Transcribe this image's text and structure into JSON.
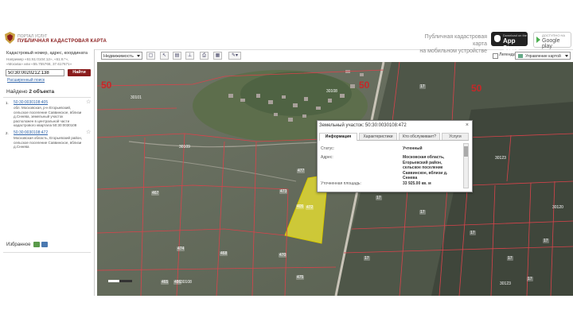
{
  "header": {
    "portal_small": "ПОРТАЛ УСЛУГ",
    "portal_title": "ПУБЛИЧНАЯ КАДАСТРОВАЯ КАРТА",
    "mobile_line1": "Публичная кадастровая карта",
    "mobile_line2": "на мобильном устройстве",
    "appstore_small": "Download on the",
    "appstore_big": "App Store",
    "gplay_small": "ДОСТУПНО НА",
    "gplay_big": "Google play"
  },
  "sidebar": {
    "search_label": "Кадастровый номер, адрес, координата",
    "example_line1": "Например «61:61:0104:12», «61:6:*»,",
    "example_line2": "«Москва» или «55.755768, 37.617671»",
    "search_value": "50:30:0020212:138",
    "search_button": "Найти",
    "advanced_search": "Расширенный поиск",
    "found_prefix": "Найдено",
    "found_count": "2 объекта",
    "results": [
      {
        "num": "1.",
        "link": "50:30:0030108:405",
        "desc": "обл. Московская, р-н Егорьевский, сельское поселение Саввинское, вблизи д.Сннева, земельный участок расположен в центральной части кадастрового квартала 50:30:0030108"
      },
      {
        "num": "2.",
        "link": "50:30:0030108:472",
        "desc": "Московская область, Егорьевский район, сельское поселение Саввинское, вблизи д.Сннева"
      }
    ],
    "favorites": "Избранное"
  },
  "toolbar": {
    "layer_select": "Недвижимость",
    "legend_label": "Легенда",
    "manage_map": "Управление картой"
  },
  "map": {
    "zone_labels": [
      "50",
      "50",
      "50"
    ],
    "plot_labels": [
      "30101",
      "30108",
      "30109",
      "30110",
      "30123",
      "30123",
      "30108",
      "30120"
    ],
    "small_nums": [
      "477",
      "472",
      "405",
      "473",
      "470",
      "468",
      "467",
      "474",
      "465",
      "475",
      "486",
      "17",
      "17",
      "17",
      "17",
      "17",
      "17",
      "17",
      "17"
    ]
  },
  "popup": {
    "title": "Земельный участок: 50:30:0030108:472",
    "tabs": [
      "Информация",
      "Характеристики",
      "Кто обслуживает?",
      "Услуги"
    ],
    "status_label": "Статус:",
    "status_value": "Учтенный",
    "address_label": "Адрес:",
    "address_value": "Московская область, Егорьевский район, сельское поселение Саввинское, вблизи д. Сннева",
    "area_label": "Уточненная площадь:",
    "area_value": "33 925.00 кв. м"
  }
}
